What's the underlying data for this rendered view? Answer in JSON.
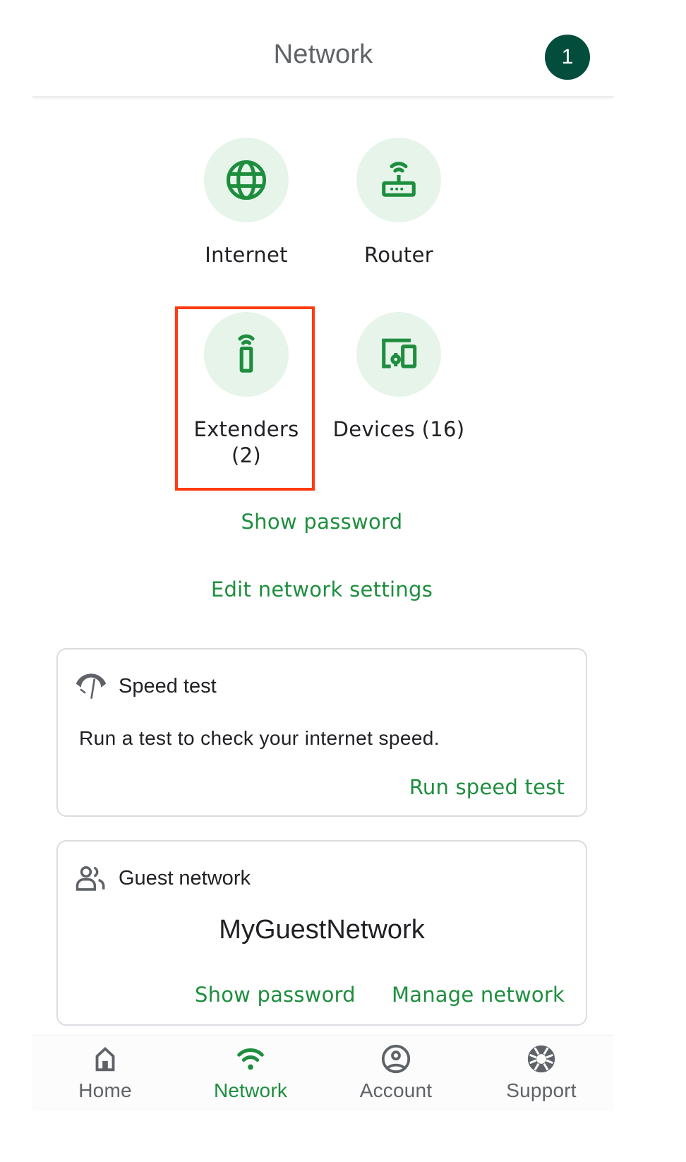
{
  "header": {
    "title": "Network",
    "avatar_initial": "1",
    "avatar_color": "#034d3d"
  },
  "tiles": [
    {
      "label": "Internet",
      "icon": "globe-icon"
    },
    {
      "label": "Router",
      "icon": "router-icon"
    },
    {
      "label_line1": "Extenders",
      "label_line2": "(2)",
      "icon": "extender-icon",
      "highlighted": true
    },
    {
      "label": "Devices (16)",
      "icon": "devices-icon"
    }
  ],
  "links": {
    "show_password": "Show password",
    "edit_network_settings": "Edit network settings"
  },
  "speed_test_card": {
    "title": "Speed test",
    "icon": "speed-test-icon",
    "description": "Run a test to check your internet speed.",
    "action": "Run speed test"
  },
  "guest_network_card": {
    "title": "Guest network",
    "icon": "guests-icon",
    "ssid": "MyGuestNetwork",
    "show_password": "Show password",
    "manage": "Manage network"
  },
  "bottom_nav": {
    "items": [
      {
        "label": "Home",
        "icon": "home-icon",
        "active": false
      },
      {
        "label": "Network",
        "icon": "wifi-icon",
        "active": true
      },
      {
        "label": "Account",
        "icon": "account-icon",
        "active": false
      },
      {
        "label": "Support",
        "icon": "support-icon",
        "active": false
      }
    ]
  },
  "colors": {
    "accent_green": "#1e8e3e",
    "tile_bg": "#e6f4ea",
    "highlight_red": "#ff3b0f",
    "icon_gray": "#5f6368"
  }
}
